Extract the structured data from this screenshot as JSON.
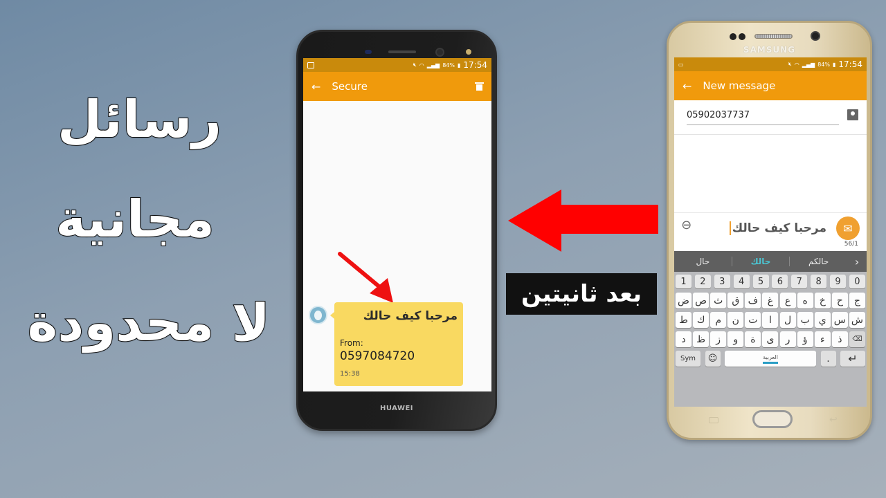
{
  "headline": {
    "line1": "رسائل",
    "line2": "مجانية",
    "line3": "لا محدودة"
  },
  "transition": {
    "label": "بعد ثانيتين",
    "arrow_color": "#ff0000"
  },
  "receiver_phone": {
    "brand": "HUAWEI",
    "status_bar": {
      "battery": "84%",
      "time": "17:54"
    },
    "app_bar": {
      "title": "Secure",
      "back_icon": "arrow-left-icon",
      "action_icon": "trash-icon"
    },
    "message": {
      "text": "مرحبا كيف حالك",
      "from_label": "From:",
      "from_number": "0597084720",
      "time": "15:38",
      "bubble_color": "#f9d961"
    }
  },
  "sender_phone": {
    "brand": "SAMSUNG",
    "status_bar": {
      "battery": "84%",
      "time": "17:54"
    },
    "app_bar": {
      "title": "New message",
      "back_icon": "arrow-left-icon"
    },
    "recipient": {
      "number": "05902037737"
    },
    "compose": {
      "text": "مرحبا كيف حالك",
      "counter": "56/1",
      "send_icon": "send-message-icon"
    },
    "suggestions": [
      "حال",
      "حالك",
      "حالكم"
    ],
    "active_suggestion": 1,
    "keyboard": {
      "number_row": [
        "1",
        "2",
        "3",
        "4",
        "5",
        "6",
        "7",
        "8",
        "9",
        "0"
      ],
      "row1": [
        "ض",
        "ص",
        "ث",
        "ق",
        "ف",
        "غ",
        "ع",
        "ه",
        "خ",
        "ح",
        "ج"
      ],
      "row2": [
        "ش",
        "س",
        "ي",
        "ب",
        "ل",
        "ا",
        "ت",
        "ن",
        "م",
        "ك",
        "ط"
      ],
      "row3": [
        "ذ",
        "ء",
        "ؤ",
        "ر",
        "ى",
        "ة",
        "و",
        "ز",
        "ظ",
        "د"
      ],
      "sym_label": "Sym",
      "space_label": "العربية",
      "period_label": ".",
      "enter_label": "↵"
    },
    "accent_color": "#f09a0c"
  }
}
